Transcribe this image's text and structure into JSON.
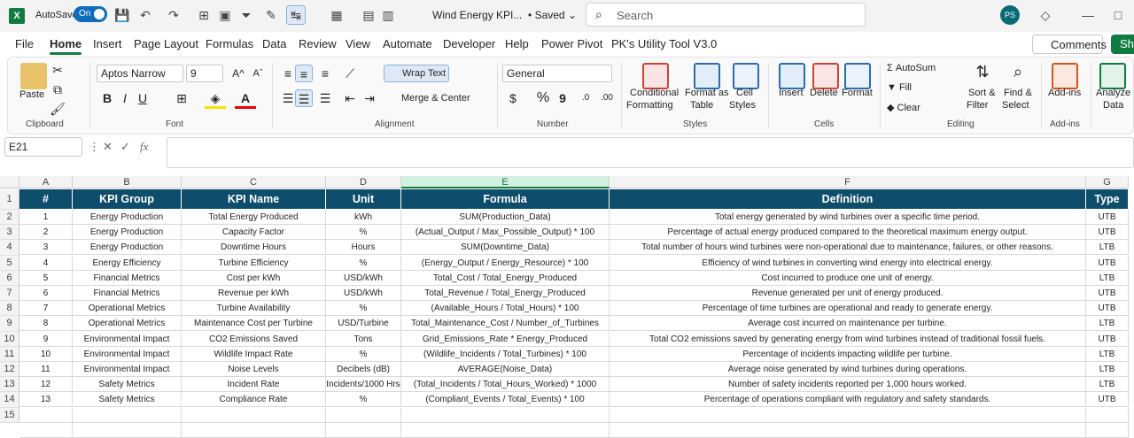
{
  "titlebar": {
    "app_letter": "X",
    "autosave_label": "AutoSave",
    "autosave_state": "On",
    "doc_title": "Wind Energy KPI...",
    "saved": "• Saved",
    "search_placeholder": "Search",
    "user_initials": "PS"
  },
  "tabs": [
    "File",
    "Home",
    "Insert",
    "Page Layout",
    "Formulas",
    "Data",
    "Review",
    "View",
    "Automate",
    "Developer",
    "Help",
    "Power Pivot",
    "PK's Utility Tool V3.0"
  ],
  "comments_label": "Comments",
  "share_label": "Sh",
  "ribbon": {
    "clipboard": {
      "paste": "Paste",
      "group": "Clipboard"
    },
    "font": {
      "name": "Aptos Narrow",
      "size": "9",
      "group": "Font",
      "bold": "B",
      "italic": "I",
      "underline": "U",
      "grow": "A^",
      "shrink": "Aˇ"
    },
    "alignment": {
      "wrap": "Wrap Text",
      "merge": "Merge & Center",
      "group": "Alignment"
    },
    "number": {
      "format": "General",
      "group": "Number",
      "currency": "$",
      "percent": "%",
      "comma": "9"
    },
    "styles": {
      "cond1": "Conditional",
      "cond2": "Formatting",
      "fmt1": "Format as",
      "fmt2": "Table",
      "cell1": "Cell",
      "cell2": "Styles",
      "group": "Styles"
    },
    "cells": {
      "insert": "Insert",
      "delete": "Delete",
      "format": "Format",
      "group": "Cells"
    },
    "editing": {
      "autosum": "AutoSum",
      "fill": "Fill",
      "clear": "Clear",
      "sort1": "Sort &",
      "sort2": "Filter",
      "find1": "Find &",
      "find2": "Select",
      "group": "Editing"
    },
    "addins": {
      "label": "Add-ins",
      "group": "Add-ins"
    },
    "analyze": {
      "l1": "Analyze",
      "l2": "Data"
    }
  },
  "formula_bar": {
    "name_box": "E21",
    "fx": "fx",
    "content": ""
  },
  "columns": [
    "A",
    "B",
    "C",
    "D",
    "E",
    "F",
    "G"
  ],
  "table": {
    "headers": [
      "#",
      "KPI Group",
      "KPI Name",
      "Unit",
      "Formula",
      "Definition",
      "Type"
    ],
    "rows": [
      [
        "1",
        "Energy Production",
        "Total Energy Produced",
        "kWh",
        "SUM(Production_Data)",
        "Total energy generated by wind turbines over a specific time period.",
        "UTB"
      ],
      [
        "2",
        "Energy Production",
        "Capacity Factor",
        "%",
        "(Actual_Output / Max_Possible_Output) * 100",
        "Percentage of actual energy produced compared to the theoretical maximum energy output.",
        "UTB"
      ],
      [
        "3",
        "Energy Production",
        "Downtime Hours",
        "Hours",
        "SUM(Downtime_Data)",
        "Total number of hours wind turbines were non-operational due to maintenance, failures, or other reasons.",
        "LTB"
      ],
      [
        "4",
        "Energy Efficiency",
        "Turbine Efficiency",
        "%",
        "(Energy_Output / Energy_Resource) * 100",
        "Efficiency of wind turbines in converting wind energy into electrical energy.",
        "UTB"
      ],
      [
        "5",
        "Financial Metrics",
        "Cost per kWh",
        "USD/kWh",
        "Total_Cost / Total_Energy_Produced",
        "Cost incurred to produce one unit of energy.",
        "LTB"
      ],
      [
        "6",
        "Financial Metrics",
        "Revenue per kWh",
        "USD/kWh",
        "Total_Revenue / Total_Energy_Produced",
        "Revenue generated per unit of energy produced.",
        "UTB"
      ],
      [
        "7",
        "Operational Metrics",
        "Turbine Availability",
        "%",
        "(Available_Hours / Total_Hours) * 100",
        "Percentage of time turbines are operational and ready to generate energy.",
        "UTB"
      ],
      [
        "8",
        "Operational Metrics",
        "Maintenance Cost per Turbine",
        "USD/Turbine",
        "Total_Maintenance_Cost / Number_of_Turbines",
        "Average cost incurred on maintenance per turbine.",
        "LTB"
      ],
      [
        "9",
        "Environmental Impact",
        "CO2 Emissions Saved",
        "Tons",
        "Grid_Emissions_Rate * Energy_Produced",
        "Total CO2 emissions saved by generating energy from wind turbines instead of traditional fossil fuels.",
        "UTB"
      ],
      [
        "10",
        "Environmental Impact",
        "Wildlife Impact Rate",
        "%",
        "(Wildlife_Incidents / Total_Turbines) * 100",
        "Percentage of incidents impacting wildlife per turbine.",
        "LTB"
      ],
      [
        "11",
        "Environmental Impact",
        "Noise Levels",
        "Decibels (dB)",
        "AVERAGE(Noise_Data)",
        "Average noise generated by wind turbines during operations.",
        "LTB"
      ],
      [
        "12",
        "Safety Metrics",
        "Incident Rate",
        "Incidents/1000 Hrs",
        "(Total_Incidents / Total_Hours_Worked) * 1000",
        "Number of safety incidents reported per 1,000 hours worked.",
        "LTB"
      ],
      [
        "13",
        "Safety Metrics",
        "Compliance Rate",
        "%",
        "(Compliant_Events / Total_Events) * 100",
        "Percentage of operations compliant with regulatory and safety standards.",
        "UTB"
      ]
    ]
  },
  "row_numbers": [
    "1",
    "2",
    "3",
    "4",
    "5",
    "6",
    "7",
    "8",
    "9",
    "10",
    "11",
    "12",
    "13",
    "14",
    "15"
  ],
  "colors": {
    "header_fill": "#0e4d6b",
    "accent": "#107c41"
  }
}
